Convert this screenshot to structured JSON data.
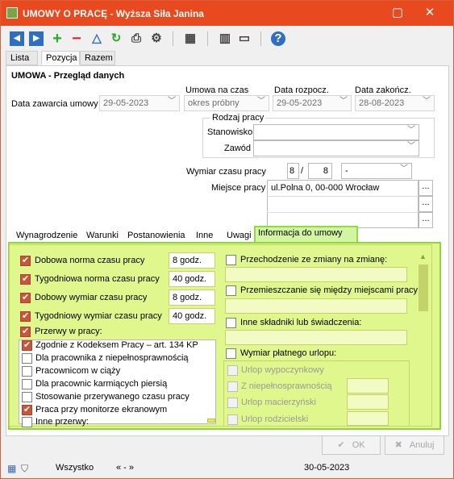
{
  "window": {
    "title": "UMOWY O PRACĘ - Wyższa Siła Janina"
  },
  "toolbar": {
    "icons": [
      "prev-icon",
      "next-icon",
      "add-icon",
      "delete-icon",
      "filter-icon",
      "refresh-icon",
      "print-icon",
      "settings-icon",
      "calculator-icon",
      "columns-icon",
      "monitor-icon",
      "help-icon"
    ]
  },
  "tabs": [
    "Lista",
    "Pozycja",
    "Razem"
  ],
  "form": {
    "header": "UMOWA - Przegląd danych",
    "date_signed": {
      "label": "Data zawarcia umowy",
      "value": "29-05-2023"
    },
    "temp_contract": {
      "label": "Umowa na czas",
      "value": "okres próbny"
    },
    "start_date": {
      "label": "Data rozpocz.",
      "value": "29-05-2023"
    },
    "end_date": {
      "label": "Data zakończ.",
      "value": "28-08-2023"
    },
    "work_type": {
      "label": "Rodzaj pracy",
      "position_label": "Stanowisko",
      "position_value": "",
      "job_label": "Zawód",
      "job_value": ""
    },
    "work_time": {
      "label": "Wymiar czasu pracy",
      "numerator": "8",
      "slash": "/",
      "denominator": "8",
      "unit": "-"
    },
    "workplace": {
      "label": "Miejsce pracy",
      "value": "ul.Polna 0, 00-000 Wrocław",
      "more": "..."
    }
  },
  "subtabs": [
    "Wynagrodzenie",
    "Warunki",
    "Postanowienia",
    "Inne",
    "Uwagi",
    "Informacja do umowy"
  ],
  "info": {
    "left": [
      {
        "label": "Dobowa norma czasu pracy",
        "value": "8 godz."
      },
      {
        "label": "Tygodniowa norma czasu pracy",
        "value": "40 godz."
      },
      {
        "label": "Dobowy wymiar czasu pracy",
        "value": "8 godz."
      },
      {
        "label": "Tygodniowy wymiar czasu pracy",
        "value": "40 godz."
      }
    ],
    "breaks_label": "Przerwy w pracy:",
    "breaks": [
      {
        "label": "Zgodnie z Kodeksem Pracy – art. 134 KP",
        "checked": true
      },
      {
        "label": "Dla pracownika z niepełnosprawnością",
        "checked": false
      },
      {
        "label": "Pracownicom w ciąży",
        "checked": false
      },
      {
        "label": "Dla pracownic karmiących piersią",
        "checked": false
      },
      {
        "label": "Stosowanie przerywanego czasu pracy",
        "checked": false
      },
      {
        "label": "Praca przy monitorze ekranowym",
        "checked": true
      },
      {
        "label": "Inne przerwy:",
        "checked": false
      }
    ],
    "right": {
      "shift": "Przechodzenie ze zmiany na zmianę:",
      "move": "Przemieszczanie się między miejscami pracy",
      "other": "Inne składniki lub świadczenia:",
      "leave": "Wymiar płatnego urlopu:",
      "leaves": [
        "Urlop wypoczynkowy",
        "Z niepełnosprawnością",
        "Urlop macierzyński",
        "Urlop rodzicielski"
      ]
    }
  },
  "buttons": {
    "ok": "OK",
    "cancel": "Anuluj"
  },
  "status": {
    "filter": "Wszystko",
    "nav": "« - »",
    "date": "30-05-2023"
  }
}
